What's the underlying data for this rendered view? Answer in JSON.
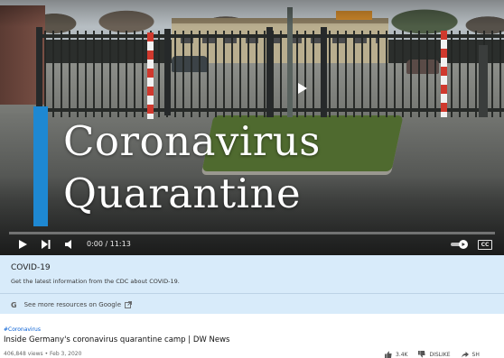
{
  "player": {
    "headline_line1": "Coronavirus",
    "headline_line2": "Quarantine",
    "time_display": "0:00 / 11:13",
    "progress_fraction": 0.0,
    "cc_label": "CC",
    "accent_color": "#1e88d2",
    "progress_color": "#ff0000"
  },
  "info_panel": {
    "title": "COVID-19",
    "description": "Get the latest information from the CDC about COVID-19.",
    "link_icon": "google-g-icon",
    "link_text": "See more resources on Google",
    "background_color": "#d8ebfa"
  },
  "video": {
    "hashtag": "#Coronavirus",
    "title": "Inside Germany's coronavirus quarantine camp | DW News",
    "meta": "406,848 views • Feb 3, 2020",
    "like_count": "3.4K",
    "dislike_label": "DISLIKE",
    "share_label": "SH"
  }
}
